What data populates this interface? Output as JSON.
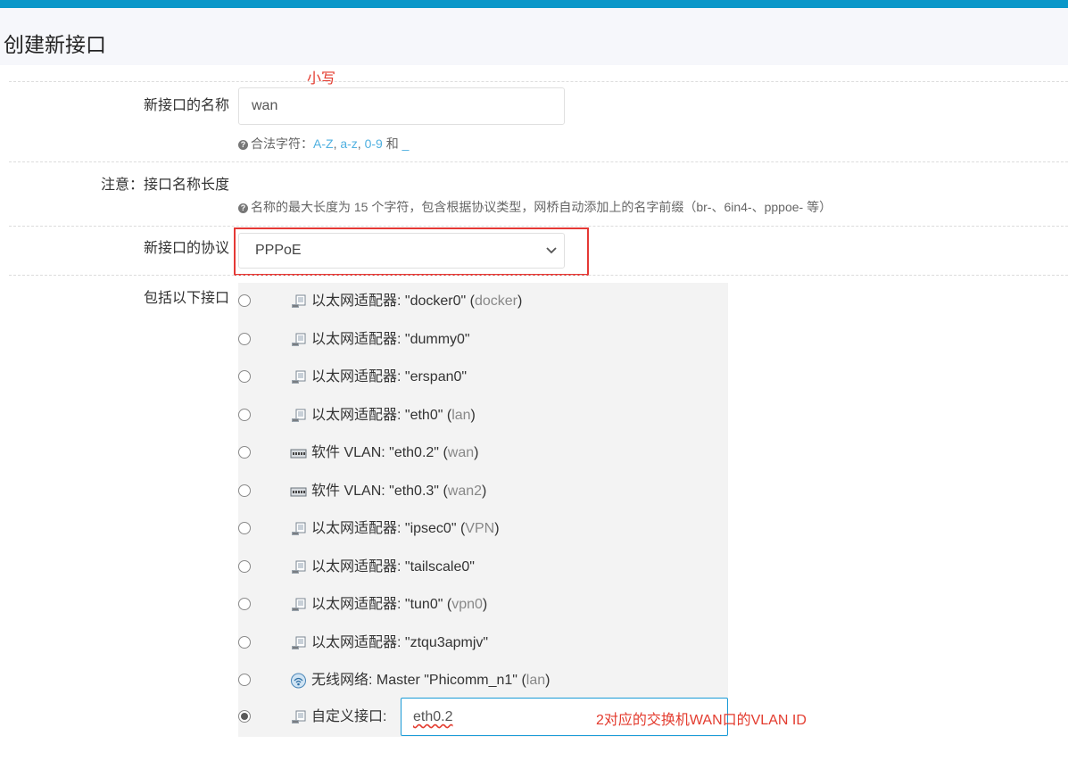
{
  "page": {
    "title": "创建新接口"
  },
  "annotations": {
    "lowercase_note": "小写",
    "vlan_note": "2对应的交换机WAN口的VLAN ID"
  },
  "form": {
    "name": {
      "label": "新接口的名称",
      "value": "wan",
      "hint_prefix": "合法字符：",
      "hint_parts": [
        "A-Z",
        ", ",
        "a-z",
        ", ",
        "0-9",
        " 和 ",
        "_"
      ]
    },
    "note": {
      "label": "注意：接口名称长度",
      "hint": "名称的最大长度为 15 个字符，包含根据协议类型，网桥自动添加上的名字前缀（br-、6in4-、pppoe- 等）"
    },
    "protocol": {
      "label": "新接口的协议",
      "selected": "PPPoE"
    },
    "interfaces": {
      "label": "包括以下接口",
      "items": [
        {
          "icon": "ethernet-adapter-icon",
          "text": "以太网适配器: \"docker0\"",
          "alias": "docker",
          "checked": false
        },
        {
          "icon": "ethernet-adapter-icon",
          "text": "以太网适配器: \"dummy0\"",
          "alias": "",
          "checked": false
        },
        {
          "icon": "ethernet-adapter-icon",
          "text": "以太网适配器: \"erspan0\"",
          "alias": "",
          "checked": false
        },
        {
          "icon": "ethernet-adapter-icon",
          "text": "以太网适配器: \"eth0\"",
          "alias": "lan",
          "checked": false
        },
        {
          "icon": "vlan-switch-icon",
          "text": "软件 VLAN: \"eth0.2\"",
          "alias": "wan",
          "checked": false
        },
        {
          "icon": "vlan-switch-icon",
          "text": "软件 VLAN: \"eth0.3\"",
          "alias": "wan2",
          "checked": false
        },
        {
          "icon": "ethernet-adapter-icon",
          "text": "以太网适配器: \"ipsec0\"",
          "alias": "VPN",
          "checked": false
        },
        {
          "icon": "ethernet-adapter-icon",
          "text": "以太网适配器: \"tailscale0\"",
          "alias": "",
          "checked": false
        },
        {
          "icon": "ethernet-adapter-icon",
          "text": "以太网适配器: \"tun0\"",
          "alias": "vpn0",
          "checked": false
        },
        {
          "icon": "ethernet-adapter-icon",
          "text": "以太网适配器: \"ztqu3apmjv\"",
          "alias": "",
          "checked": false
        },
        {
          "icon": "wifi-network-icon",
          "text": "无线网络: Master \"Phicomm_n1\"",
          "alias": "lan",
          "checked": false
        }
      ],
      "custom": {
        "label": "自定义接口:",
        "value": "eth0.2",
        "checked": true
      }
    }
  }
}
